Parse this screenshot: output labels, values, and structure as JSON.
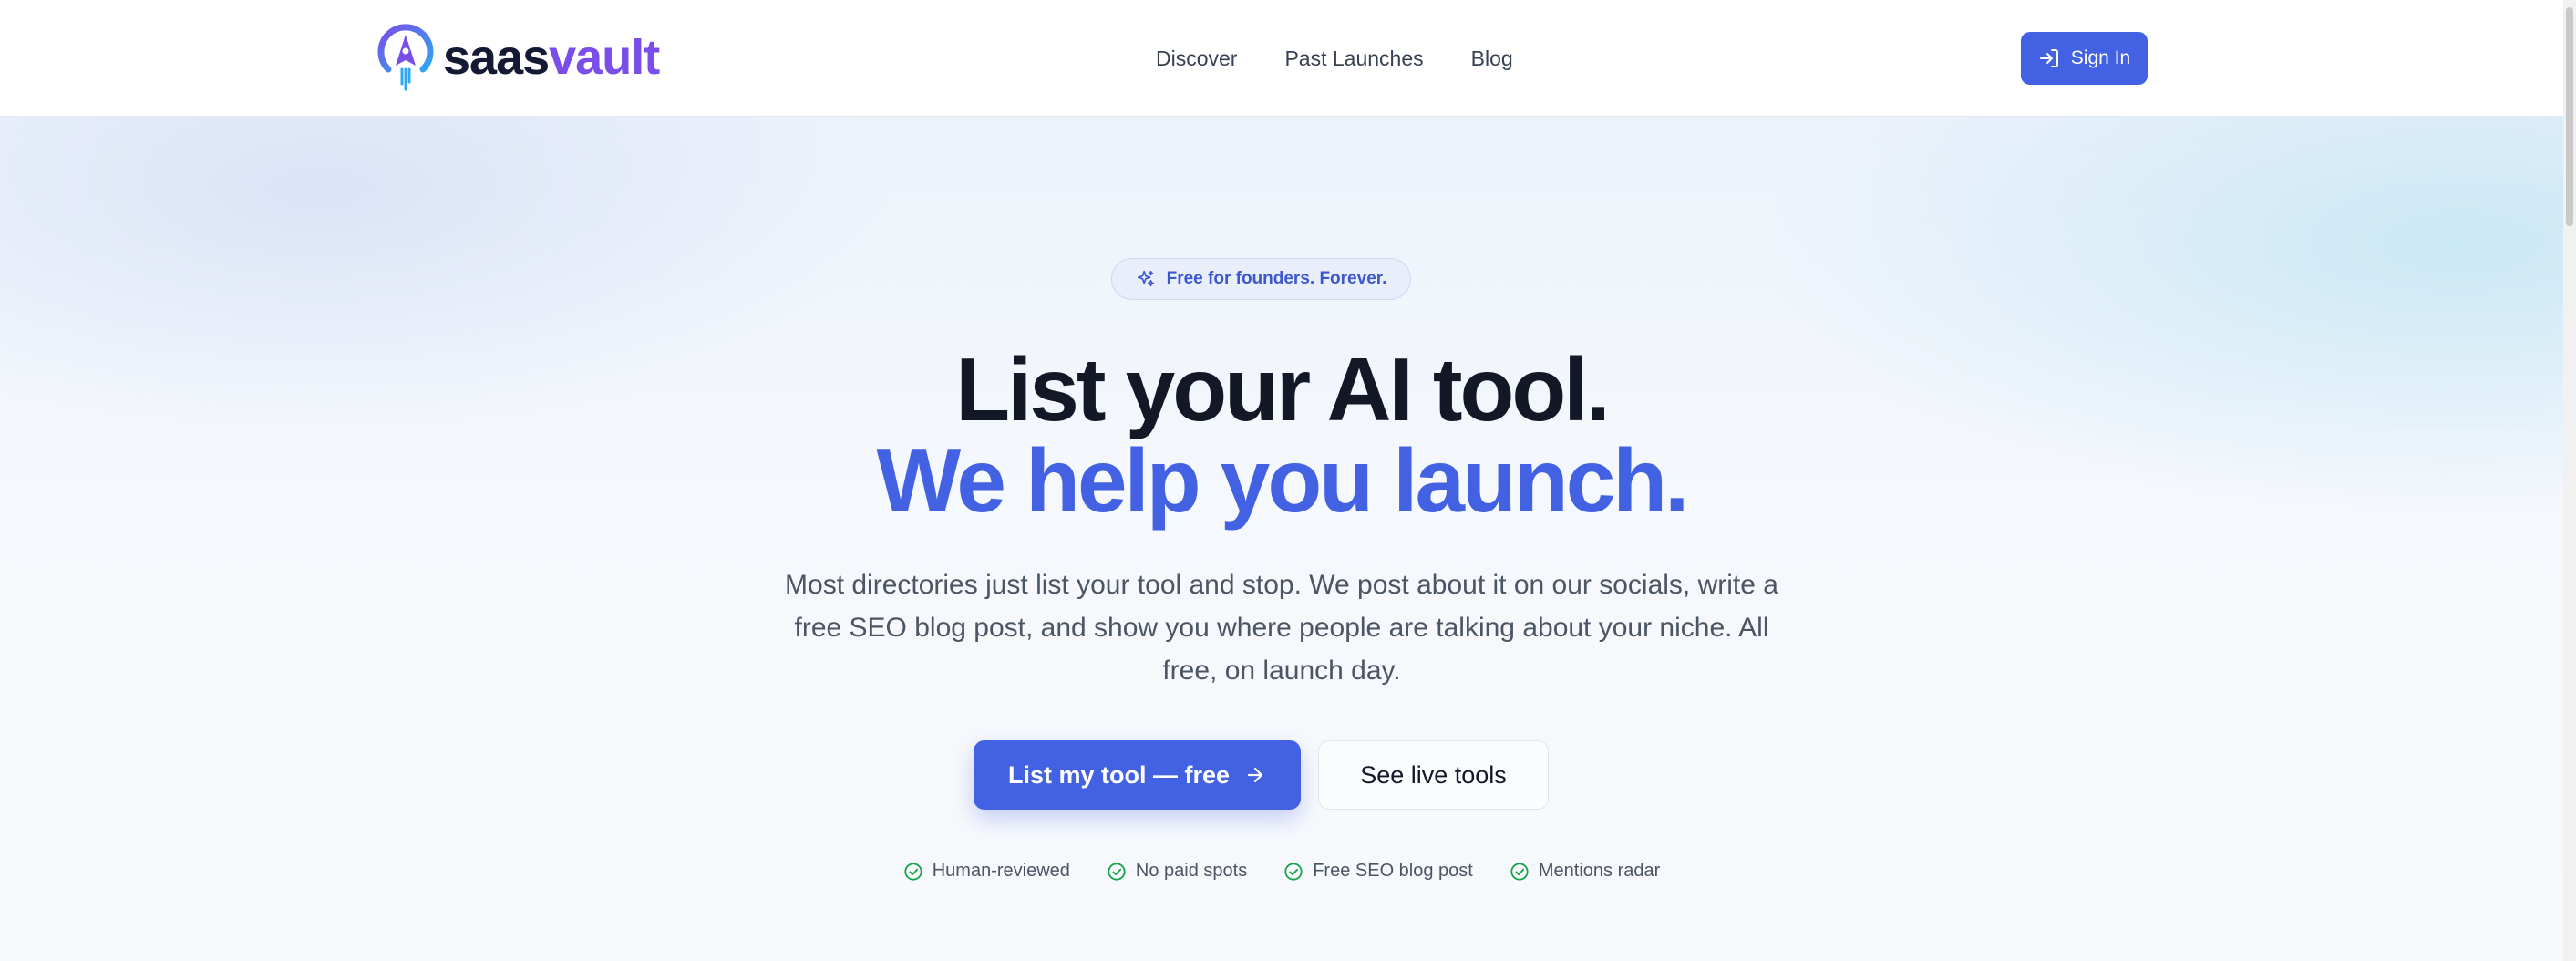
{
  "brand": {
    "name_part1": "saas",
    "name_part2": "vault",
    "colors": {
      "dark": "#141a33",
      "purple": "#7a4ee8",
      "cyan": "#2ea8f0"
    }
  },
  "nav": {
    "links": [
      {
        "label": "Discover"
      },
      {
        "label": "Past Launches"
      },
      {
        "label": "Blog"
      }
    ],
    "signin_label": "Sign In",
    "signin_icon": "log-in-icon"
  },
  "hero": {
    "badge": {
      "text": "Free for founders. Forever.",
      "icon": "sparkles-icon"
    },
    "headline_line1": "List your AI tool.",
    "headline_line2": "We help you launch.",
    "subtitle": "Most directories just list your tool and stop. We post about it on our socials, write a free SEO blog post, and show you where people are talking about your niche. All free, on launch day.",
    "cta_primary": "List my tool — free",
    "cta_primary_icon": "arrow-right-icon",
    "cta_secondary": "See live tools",
    "features": [
      {
        "label": "Human-reviewed",
        "icon": "check-circle-icon"
      },
      {
        "label": "No paid spots",
        "icon": "check-circle-icon"
      },
      {
        "label": "Free SEO blog post",
        "icon": "check-circle-icon"
      },
      {
        "label": "Mentions radar",
        "icon": "check-circle-icon"
      }
    ]
  },
  "colors": {
    "accent": "#4361e3",
    "text_dark": "#121826",
    "text_muted": "#4b5563",
    "check_green": "#16a34a"
  }
}
